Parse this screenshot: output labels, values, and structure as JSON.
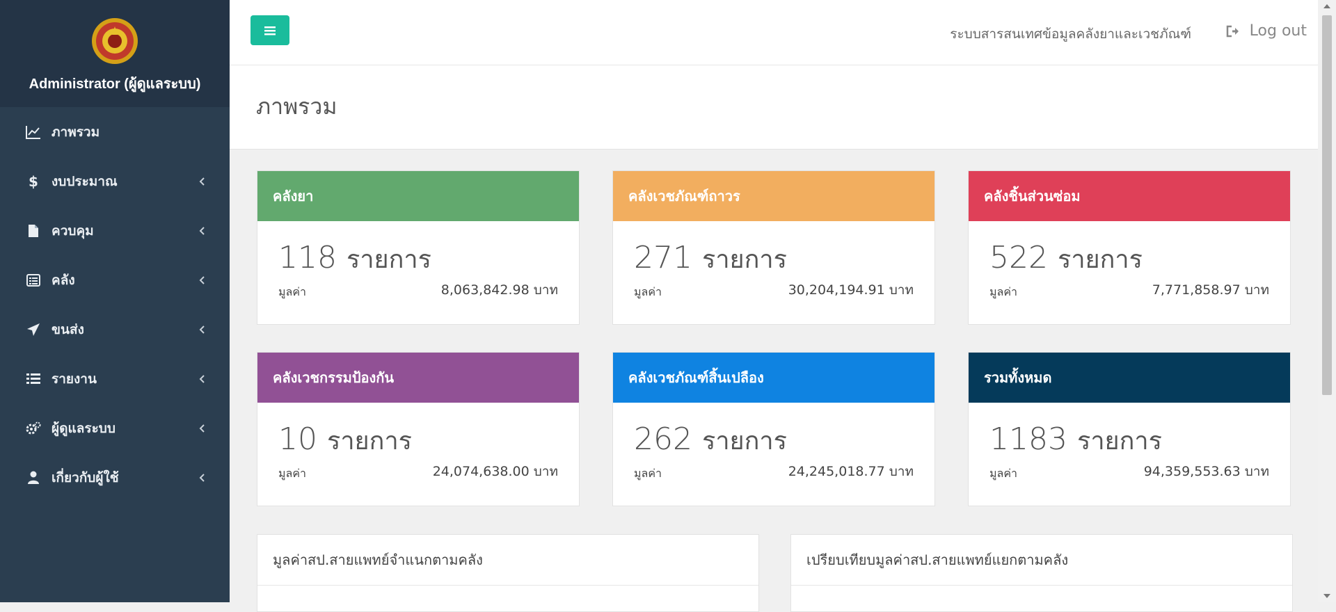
{
  "sidebar": {
    "user": "Administrator (ผู้ดูแลระบบ)",
    "items": [
      {
        "label": "ภาพรวม",
        "icon": "line-chart-icon",
        "has_submenu": false
      },
      {
        "label": "งบประมาณ",
        "icon": "dollar-icon",
        "has_submenu": true
      },
      {
        "label": "ควบคุม",
        "icon": "file-icon",
        "has_submenu": true
      },
      {
        "label": "คลัง",
        "icon": "list-alt-icon",
        "has_submenu": true
      },
      {
        "label": "ขนส่ง",
        "icon": "paper-plane-icon",
        "has_submenu": true
      },
      {
        "label": "รายงาน",
        "icon": "list-icon",
        "has_submenu": true
      },
      {
        "label": "ผู้ดูแลระบบ",
        "icon": "gears-icon",
        "has_submenu": true
      },
      {
        "label": "เกี่ยวกับผู้ใช้",
        "icon": "user-icon",
        "has_submenu": true
      }
    ]
  },
  "topbar": {
    "system_title": "ระบบสารสนเทศข้อมูลคลังยาและเวชภัณฑ์",
    "logout_label": "Log out"
  },
  "page": {
    "title": "ภาพรวม"
  },
  "cards": [
    {
      "title": "คลังยา",
      "count": "118",
      "unit": "รายการ",
      "value_label": "มูลค่า",
      "value": "8,063,842.98 บาท",
      "color": "#62a96e"
    },
    {
      "title": "คลังเวชภัณฑ์ถาวร",
      "count": "271",
      "unit": "รายการ",
      "value_label": "มูลค่า",
      "value": "30,204,194.91 บาท",
      "color": "#f2ae5f"
    },
    {
      "title": "คลังชิ้นส่วนซ่อม",
      "count": "522",
      "unit": "รายการ",
      "value_label": "มูลค่า",
      "value": "7,771,858.97 บาท",
      "color": "#df4058"
    },
    {
      "title": "คลังเวชกรรมป้องกัน",
      "count": "10",
      "unit": "รายการ",
      "value_label": "มูลค่า",
      "value": "24,074,638.00 บาท",
      "color": "#915195"
    },
    {
      "title": "คลังเวชภัณฑ์สิ้นเปลือง",
      "count": "262",
      "unit": "รายการ",
      "value_label": "มูลค่า",
      "value": "24,245,018.77 บาท",
      "color": "#0f83e1"
    },
    {
      "title": "รวมทั้งหมด",
      "count": "1183",
      "unit": "รายการ",
      "value_label": "มูลค่า",
      "value": "94,359,553.63 บาท",
      "color": "#053a5a"
    }
  ],
  "panels": [
    {
      "title": "มูลค่าสป.สายแพทย์จำแนกตามคลัง"
    },
    {
      "title": "เปรียบเทียบมูลค่าสป.สายแพทย์แยกตามคลัง"
    }
  ],
  "colors": {
    "sidebar": "#2b3e50",
    "toggle": "#1abc9c"
  }
}
